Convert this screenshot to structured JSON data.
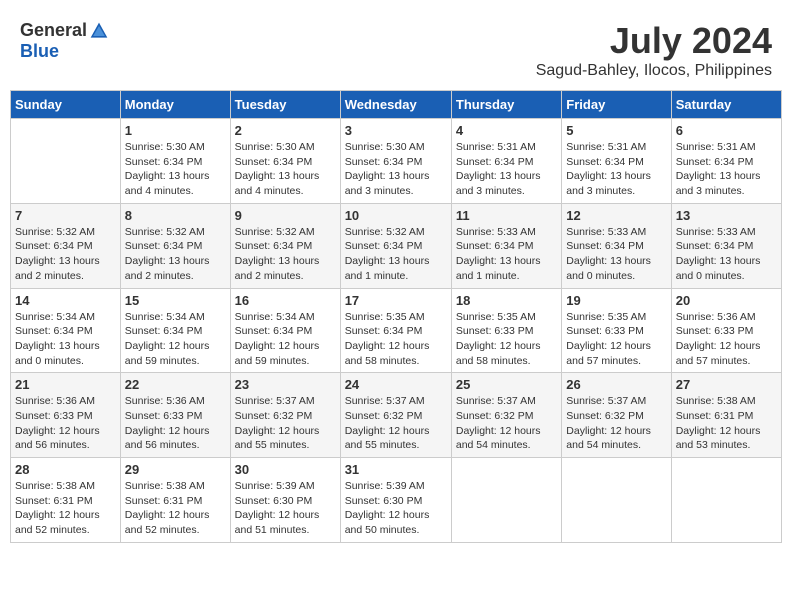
{
  "header": {
    "logo_general": "General",
    "logo_blue": "Blue",
    "month_year": "July 2024",
    "location": "Sagud-Bahley, Ilocos, Philippines"
  },
  "weekdays": [
    "Sunday",
    "Monday",
    "Tuesday",
    "Wednesday",
    "Thursday",
    "Friday",
    "Saturday"
  ],
  "weeks": [
    [
      {
        "day": "",
        "sunrise": "",
        "sunset": "",
        "daylight": ""
      },
      {
        "day": "1",
        "sunrise": "Sunrise: 5:30 AM",
        "sunset": "Sunset: 6:34 PM",
        "daylight": "Daylight: 13 hours and 4 minutes."
      },
      {
        "day": "2",
        "sunrise": "Sunrise: 5:30 AM",
        "sunset": "Sunset: 6:34 PM",
        "daylight": "Daylight: 13 hours and 4 minutes."
      },
      {
        "day": "3",
        "sunrise": "Sunrise: 5:30 AM",
        "sunset": "Sunset: 6:34 PM",
        "daylight": "Daylight: 13 hours and 3 minutes."
      },
      {
        "day": "4",
        "sunrise": "Sunrise: 5:31 AM",
        "sunset": "Sunset: 6:34 PM",
        "daylight": "Daylight: 13 hours and 3 minutes."
      },
      {
        "day": "5",
        "sunrise": "Sunrise: 5:31 AM",
        "sunset": "Sunset: 6:34 PM",
        "daylight": "Daylight: 13 hours and 3 minutes."
      },
      {
        "day": "6",
        "sunrise": "Sunrise: 5:31 AM",
        "sunset": "Sunset: 6:34 PM",
        "daylight": "Daylight: 13 hours and 3 minutes."
      }
    ],
    [
      {
        "day": "7",
        "sunrise": "Sunrise: 5:32 AM",
        "sunset": "Sunset: 6:34 PM",
        "daylight": "Daylight: 13 hours and 2 minutes."
      },
      {
        "day": "8",
        "sunrise": "Sunrise: 5:32 AM",
        "sunset": "Sunset: 6:34 PM",
        "daylight": "Daylight: 13 hours and 2 minutes."
      },
      {
        "day": "9",
        "sunrise": "Sunrise: 5:32 AM",
        "sunset": "Sunset: 6:34 PM",
        "daylight": "Daylight: 13 hours and 2 minutes."
      },
      {
        "day": "10",
        "sunrise": "Sunrise: 5:32 AM",
        "sunset": "Sunset: 6:34 PM",
        "daylight": "Daylight: 13 hours and 1 minute."
      },
      {
        "day": "11",
        "sunrise": "Sunrise: 5:33 AM",
        "sunset": "Sunset: 6:34 PM",
        "daylight": "Daylight: 13 hours and 1 minute."
      },
      {
        "day": "12",
        "sunrise": "Sunrise: 5:33 AM",
        "sunset": "Sunset: 6:34 PM",
        "daylight": "Daylight: 13 hours and 0 minutes."
      },
      {
        "day": "13",
        "sunrise": "Sunrise: 5:33 AM",
        "sunset": "Sunset: 6:34 PM",
        "daylight": "Daylight: 13 hours and 0 minutes."
      }
    ],
    [
      {
        "day": "14",
        "sunrise": "Sunrise: 5:34 AM",
        "sunset": "Sunset: 6:34 PM",
        "daylight": "Daylight: 13 hours and 0 minutes."
      },
      {
        "day": "15",
        "sunrise": "Sunrise: 5:34 AM",
        "sunset": "Sunset: 6:34 PM",
        "daylight": "Daylight: 12 hours and 59 minutes."
      },
      {
        "day": "16",
        "sunrise": "Sunrise: 5:34 AM",
        "sunset": "Sunset: 6:34 PM",
        "daylight": "Daylight: 12 hours and 59 minutes."
      },
      {
        "day": "17",
        "sunrise": "Sunrise: 5:35 AM",
        "sunset": "Sunset: 6:34 PM",
        "daylight": "Daylight: 12 hours and 58 minutes."
      },
      {
        "day": "18",
        "sunrise": "Sunrise: 5:35 AM",
        "sunset": "Sunset: 6:33 PM",
        "daylight": "Daylight: 12 hours and 58 minutes."
      },
      {
        "day": "19",
        "sunrise": "Sunrise: 5:35 AM",
        "sunset": "Sunset: 6:33 PM",
        "daylight": "Daylight: 12 hours and 57 minutes."
      },
      {
        "day": "20",
        "sunrise": "Sunrise: 5:36 AM",
        "sunset": "Sunset: 6:33 PM",
        "daylight": "Daylight: 12 hours and 57 minutes."
      }
    ],
    [
      {
        "day": "21",
        "sunrise": "Sunrise: 5:36 AM",
        "sunset": "Sunset: 6:33 PM",
        "daylight": "Daylight: 12 hours and 56 minutes."
      },
      {
        "day": "22",
        "sunrise": "Sunrise: 5:36 AM",
        "sunset": "Sunset: 6:33 PM",
        "daylight": "Daylight: 12 hours and 56 minutes."
      },
      {
        "day": "23",
        "sunrise": "Sunrise: 5:37 AM",
        "sunset": "Sunset: 6:32 PM",
        "daylight": "Daylight: 12 hours and 55 minutes."
      },
      {
        "day": "24",
        "sunrise": "Sunrise: 5:37 AM",
        "sunset": "Sunset: 6:32 PM",
        "daylight": "Daylight: 12 hours and 55 minutes."
      },
      {
        "day": "25",
        "sunrise": "Sunrise: 5:37 AM",
        "sunset": "Sunset: 6:32 PM",
        "daylight": "Daylight: 12 hours and 54 minutes."
      },
      {
        "day": "26",
        "sunrise": "Sunrise: 5:37 AM",
        "sunset": "Sunset: 6:32 PM",
        "daylight": "Daylight: 12 hours and 54 minutes."
      },
      {
        "day": "27",
        "sunrise": "Sunrise: 5:38 AM",
        "sunset": "Sunset: 6:31 PM",
        "daylight": "Daylight: 12 hours and 53 minutes."
      }
    ],
    [
      {
        "day": "28",
        "sunrise": "Sunrise: 5:38 AM",
        "sunset": "Sunset: 6:31 PM",
        "daylight": "Daylight: 12 hours and 52 minutes."
      },
      {
        "day": "29",
        "sunrise": "Sunrise: 5:38 AM",
        "sunset": "Sunset: 6:31 PM",
        "daylight": "Daylight: 12 hours and 52 minutes."
      },
      {
        "day": "30",
        "sunrise": "Sunrise: 5:39 AM",
        "sunset": "Sunset: 6:30 PM",
        "daylight": "Daylight: 12 hours and 51 minutes."
      },
      {
        "day": "31",
        "sunrise": "Sunrise: 5:39 AM",
        "sunset": "Sunset: 6:30 PM",
        "daylight": "Daylight: 12 hours and 50 minutes."
      },
      {
        "day": "",
        "sunrise": "",
        "sunset": "",
        "daylight": ""
      },
      {
        "day": "",
        "sunrise": "",
        "sunset": "",
        "daylight": ""
      },
      {
        "day": "",
        "sunrise": "",
        "sunset": "",
        "daylight": ""
      }
    ]
  ]
}
